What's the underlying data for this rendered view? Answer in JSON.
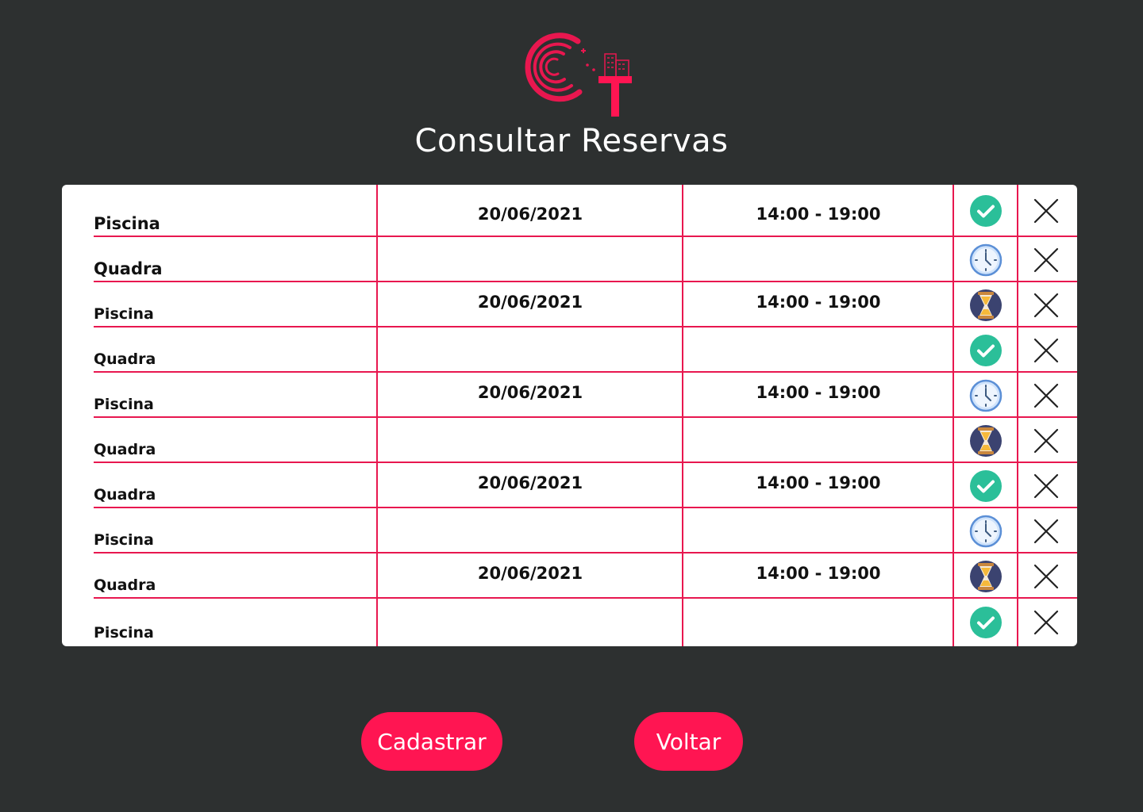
{
  "header": {
    "title": "Consultar Reservas"
  },
  "colors": {
    "background": "#2d3030",
    "accent": "#e8174f",
    "button": "#ff1552",
    "card": "#ffffff"
  },
  "reservations": [
    {
      "name": "Piscina",
      "date": "20/06/2021",
      "time": "14:00 - 19:00",
      "status_icon": "check-icon"
    },
    {
      "name": "Quadra",
      "date": "",
      "time": "",
      "status_icon": "clock-icon"
    },
    {
      "name": "Piscina",
      "date": "20/06/2021",
      "time": "14:00 - 19:00",
      "status_icon": "hourglass-icon"
    },
    {
      "name": "Quadra",
      "date": "",
      "time": "",
      "status_icon": "check-icon"
    },
    {
      "name": "Piscina",
      "date": "20/06/2021",
      "time": "14:00 - 19:00",
      "status_icon": "clock-icon"
    },
    {
      "name": "Quadra",
      "date": "",
      "time": "",
      "status_icon": "hourglass-icon"
    },
    {
      "name": "Quadra",
      "date": "20/06/2021",
      "time": "14:00 - 19:00",
      "status_icon": "check-icon"
    },
    {
      "name": "Piscina",
      "date": "",
      "time": "",
      "status_icon": "clock-icon"
    },
    {
      "name": "Quadra",
      "date": "20/06/2021",
      "time": "14:00 - 19:00",
      "status_icon": "hourglass-icon"
    },
    {
      "name": "Piscina",
      "date": "",
      "time": "",
      "status_icon": "check-icon"
    }
  ],
  "delete_icon": "close-icon",
  "actions": {
    "register_label": "Cadastrar",
    "back_label": "Voltar"
  }
}
